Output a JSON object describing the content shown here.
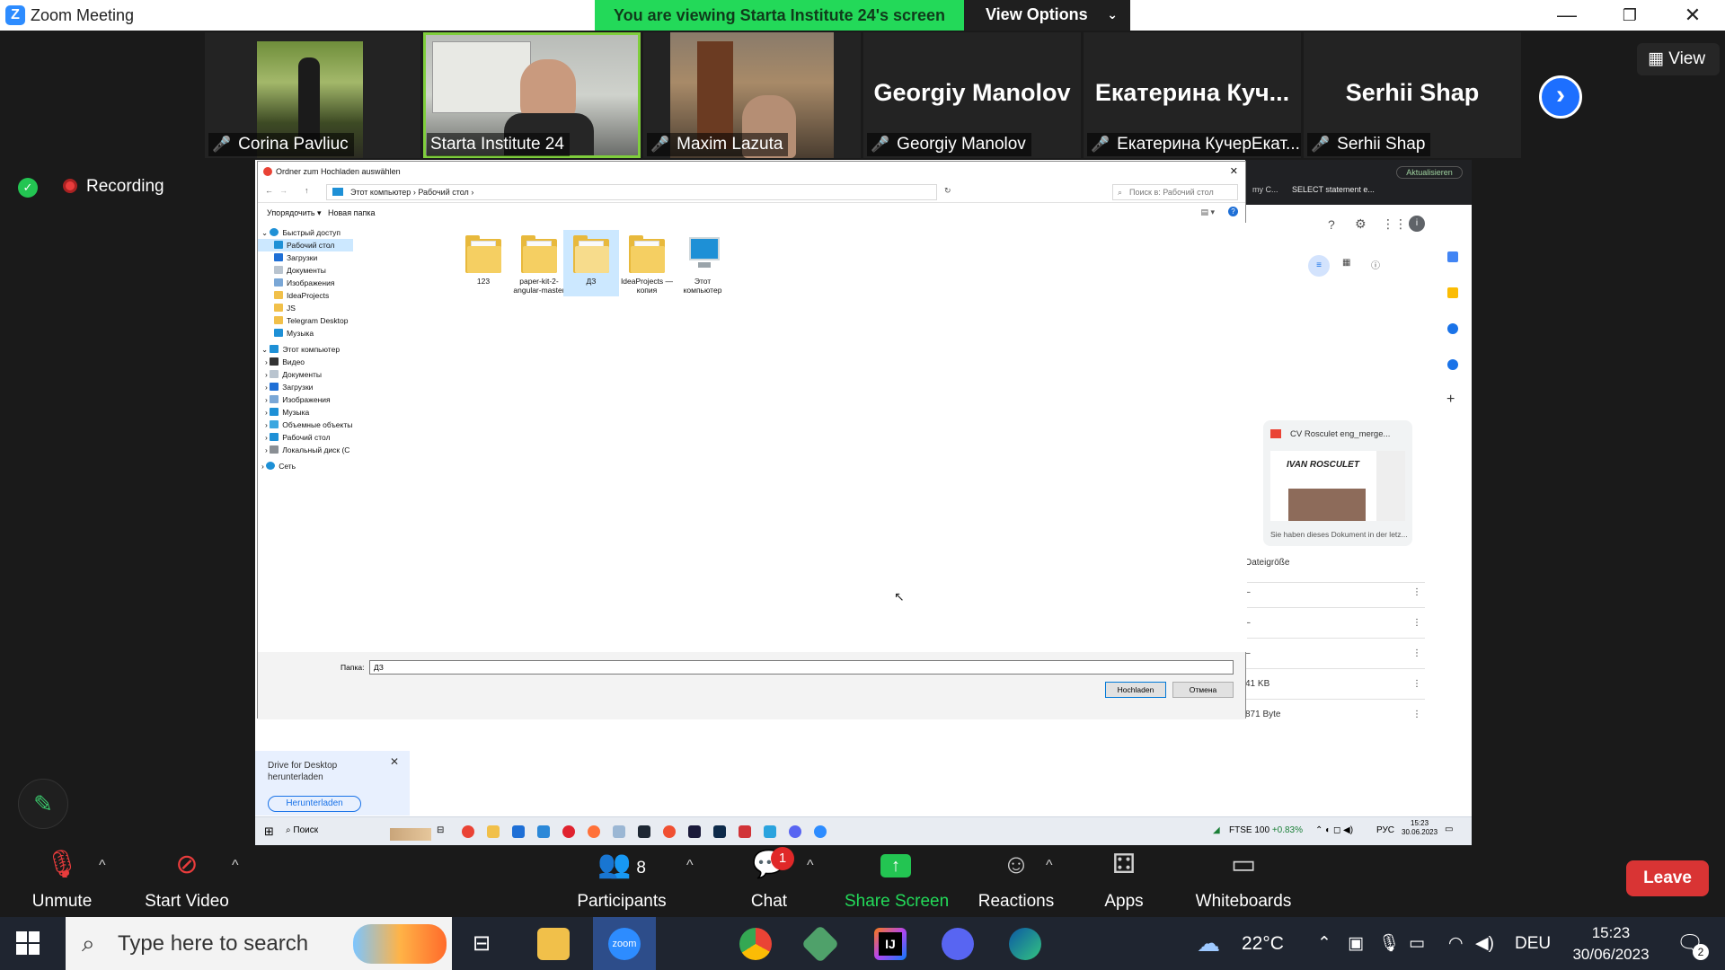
{
  "window": {
    "title": "Zoom Meeting",
    "app_icon": "zoom-logo-icon"
  },
  "banner": {
    "viewing_text": "You are viewing Starta Institute 24's screen",
    "view_options_label": "View Options"
  },
  "gallery": {
    "participants": [
      {
        "name": "Corina Pavliuc",
        "display": "",
        "muted": true,
        "video": true
      },
      {
        "name": "Starta Institute 24",
        "display": "",
        "muted": false,
        "video": true,
        "active_speaker": true
      },
      {
        "name": "Maxim Lazuta",
        "display": "",
        "muted": true,
        "video": true
      },
      {
        "name": "Georgiy Manolov",
        "display": "Georgiy Manolov",
        "muted": true,
        "video": false
      },
      {
        "name": "Екатерина КучерЕкат...",
        "display": "Екатерина  Куч...",
        "muted": true,
        "video": false
      },
      {
        "name": "Serhii Shap",
        "display": "Serhii Shap",
        "muted": true,
        "video": false
      }
    ],
    "view_button_label": "View"
  },
  "recording": {
    "label": "Recording"
  },
  "dialog": {
    "title": "Ordner zum Hochladen auswählen",
    "breadcrumb": [
      "Этот компьютер",
      "Рабочий стол"
    ],
    "search_placeholder": "Поиск в: Рабочий стол",
    "toolbar": {
      "organize": "Упорядочить ▾",
      "new_folder": "Новая папка"
    },
    "nav_quick_access": "Быстрый доступ",
    "nav_quick": [
      "Рабочий стол",
      "Загрузки",
      "Документы",
      "Изображения",
      "IdeaProjects",
      "JS",
      "Telegram Desktop",
      "Музыка"
    ],
    "nav_this_pc": "Этот компьютер",
    "nav_pc": [
      "Видео",
      "Документы",
      "Загрузки",
      "Изображения",
      "Музыка",
      "Объемные объекты",
      "Рабочий стол",
      "Локальный диск (C"
    ],
    "nav_network": "Сеть",
    "files": [
      {
        "name": "123",
        "type": "folder"
      },
      {
        "name": "paper-kit-2-angular-master",
        "type": "folder"
      },
      {
        "name": "ДЗ",
        "type": "folder",
        "selected": true
      },
      {
        "name": "IdeaProjects — копия",
        "type": "folder"
      },
      {
        "name": "Этот компьютер",
        "type": "pc"
      }
    ],
    "folder_label": "Папка:",
    "folder_value": "ДЗ",
    "upload_button": "Hochladen",
    "cancel_button": "Отмена"
  },
  "drive_tip": {
    "text": "Drive for Desktop herunterladen",
    "button": "Herunterladen"
  },
  "drive_panel": {
    "tab_label": "my C...",
    "tab2_label": "SELECT statement e...",
    "update_label": "Aktualisieren",
    "suggested_file": "CV Rosculet eng_merge...",
    "preview_name": "IVAN ROSCULET",
    "suggested_note": "Sie haben dieses Dokument in der letz...",
    "column_header": "Dateigröße",
    "sizes": [
      "–",
      "–",
      "–",
      "41 KB",
      "871 Byte"
    ]
  },
  "remote_taskbar": {
    "search": "Поиск",
    "ticker": "FTSE 100",
    "ticker_change": "+0.83%",
    "lang": "РУС",
    "time": "15:23",
    "date": "30.06.2023"
  },
  "controls": {
    "unmute": "Unmute",
    "start_video": "Start Video",
    "participants": "Participants",
    "participants_count": "8",
    "chat": "Chat",
    "chat_badge": "1",
    "share_screen": "Share Screen",
    "reactions": "Reactions",
    "apps": "Apps",
    "whiteboards": "Whiteboards",
    "leave": "Leave"
  },
  "taskbar": {
    "search_placeholder": "Type here to search",
    "weather": "22°C",
    "lang": "DEU",
    "time": "15:23",
    "date": "30/06/2023",
    "notif_count": "2"
  }
}
